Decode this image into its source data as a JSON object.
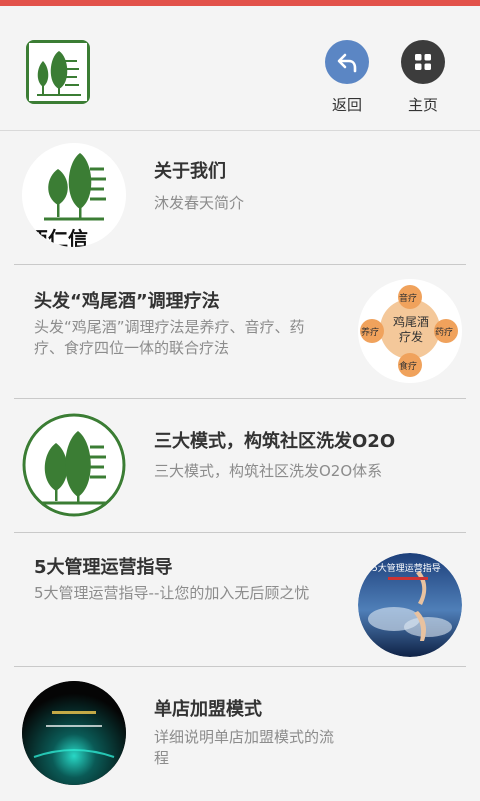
{
  "header": {
    "accent_color": "#e2524a",
    "logo_icon": "tree-logo-icon",
    "back_label": "返回",
    "home_label": "主页"
  },
  "items": [
    {
      "title": "关于我们",
      "desc": "沐发春天简介",
      "thumb_text": "西仁信"
    },
    {
      "title": "头发“鸡尾酒”调理疗法",
      "desc": "头发“鸡尾酒”调理疗法是养疗、音疗、药疗、食疗四位一体的联合疗法",
      "thumb_center": "鸡尾酒疗发",
      "thumb_labels": [
        "音疗",
        "养疗",
        "药疗",
        "食疗"
      ]
    },
    {
      "title": "三大模式，构筑社区洗发O2O",
      "desc": "三大模式，构筑社区洗发O2O体系"
    },
    {
      "title": "5大管理运营指导",
      "desc": "5大管理运营指导--让您的加入无后顾之忧",
      "thumb_text": "5大管理运营指导"
    },
    {
      "title": "单店加盟模式",
      "desc": "详细说明单店加盟模式的流程"
    }
  ]
}
